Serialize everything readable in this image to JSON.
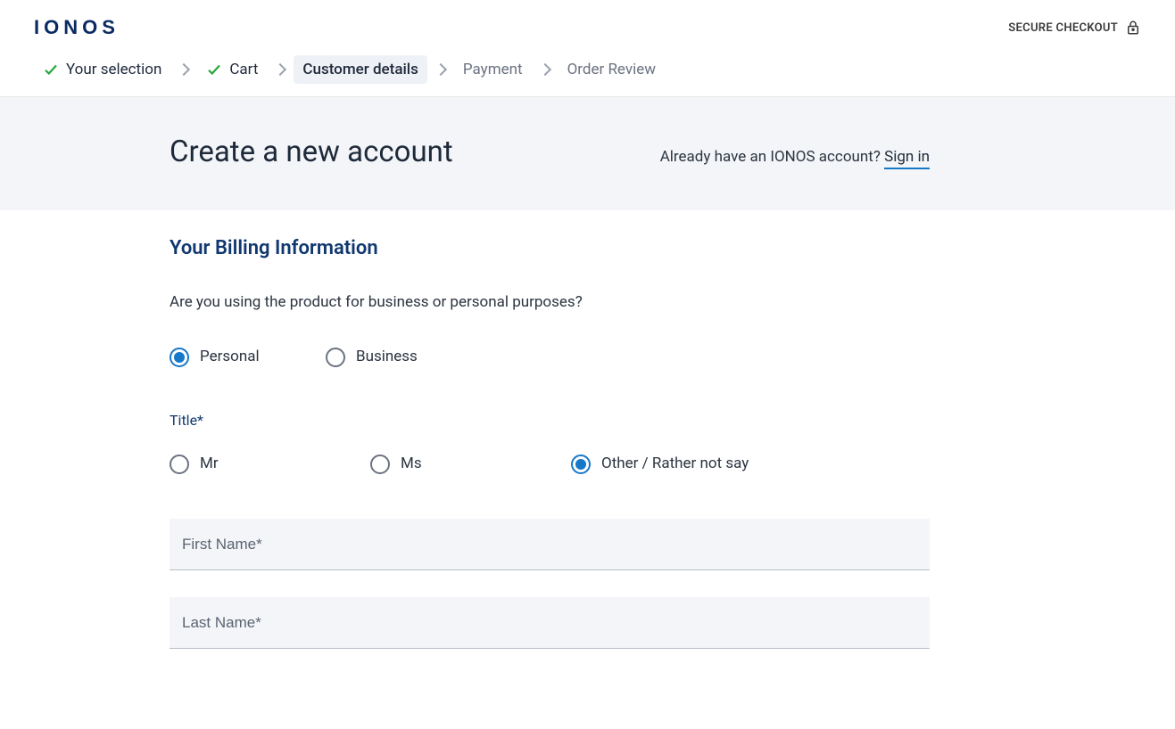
{
  "header": {
    "logo": "IONOS",
    "secure": "SECURE CHECKOUT"
  },
  "breadcrumb": {
    "steps": [
      {
        "label": "Your selection"
      },
      {
        "label": "Cart"
      },
      {
        "label": "Customer details"
      },
      {
        "label": "Payment"
      },
      {
        "label": "Order Review"
      }
    ]
  },
  "hero": {
    "title": "Create a new account",
    "signin_prompt": "Already have an IONOS account? ",
    "signin_link": "Sign in"
  },
  "billing": {
    "heading": "Your Billing Information",
    "purpose_question": "Are you using the product for business or personal purposes?",
    "purpose": {
      "personal": "Personal",
      "business": "Business"
    },
    "title_label": "Title*",
    "title_options": {
      "mr": "Mr",
      "ms": "Ms",
      "other": "Other / Rather not say"
    },
    "first_name_placeholder": "First Name*",
    "last_name_placeholder": "Last Name*"
  }
}
